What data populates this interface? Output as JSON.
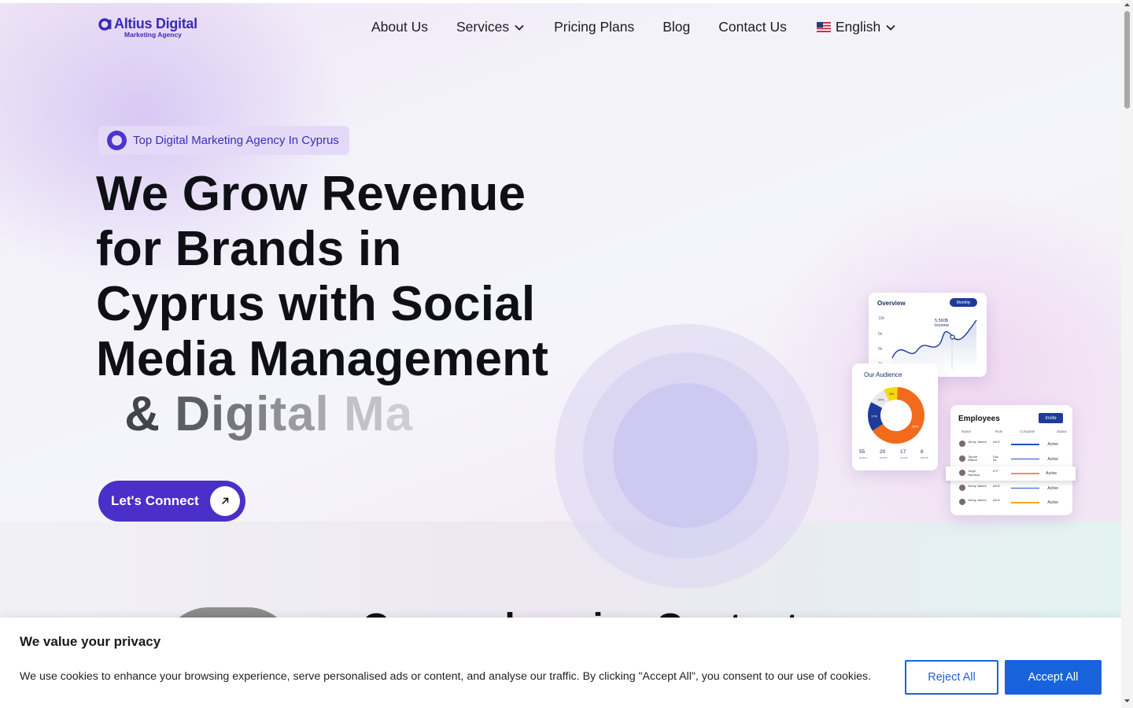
{
  "brand": {
    "name": "Altius Digital",
    "tagline": "Marketing Agency",
    "accent": "#4a2fc9"
  },
  "nav": {
    "items": [
      {
        "label": "About Us",
        "has_dropdown": false
      },
      {
        "label": "Services",
        "has_dropdown": true
      },
      {
        "label": "Pricing Plans",
        "has_dropdown": false
      },
      {
        "label": "Blog",
        "has_dropdown": false
      },
      {
        "label": "Contact Us",
        "has_dropdown": false
      }
    ],
    "language": {
      "label": "English",
      "icon": "us-flag-icon"
    }
  },
  "hero": {
    "badge": "Top Digital Marketing Agency In Cyprus",
    "title_lines": [
      "We Grow Revenue",
      "for Brands in",
      "Cyprus with Social",
      "Media Management"
    ],
    "typed_text": " & Digital Ma",
    "cta_label": "Let's Connect",
    "cta_icon": "arrow-up-right-icon"
  },
  "dashboard": {
    "overview": {
      "title": "Overview",
      "period": "Monthly",
      "y_ticks": [
        "10k",
        "5k",
        "5k",
        "1k"
      ],
      "value": "5,560$",
      "value_label": "Income"
    },
    "audience": {
      "title": "Our Audience",
      "slices": [
        {
          "label": "65%",
          "value": 65,
          "color": "#f26a1b"
        },
        {
          "label": "17%",
          "value": 17,
          "color": "#1e3a9a"
        },
        {
          "label": "20%",
          "value": 10,
          "color": "#e8e8ee"
        },
        {
          "label": "8%",
          "value": 8,
          "color": "#f5d90a"
        }
      ],
      "stats": [
        {
          "value": "55",
          "label": "years"
        },
        {
          "value": "20",
          "label": "years"
        },
        {
          "value": "17",
          "label": "years"
        },
        {
          "value": "8",
          "label": "years"
        }
      ]
    },
    "employees": {
      "title": "Employees",
      "invite_label": "Invite",
      "columns": [
        "Name",
        "Role",
        "Complete",
        "Status"
      ],
      "rows": [
        {
          "name": "Jenny James",
          "role": "Ad D",
          "status": "Active",
          "color": "#1e4fd0"
        },
        {
          "name": "Tyrone Wilson",
          "role": "Doc tor",
          "status": "Active",
          "color": "#1e4fd0"
        },
        {
          "name": "Jorge Harrison",
          "role": "D P",
          "status": "Active",
          "color": "#f08a6a"
        },
        {
          "name": "Jenny James",
          "role": "Ad D",
          "status": "Active",
          "color": "#1e4fd0"
        },
        {
          "name": "Jenny James",
          "role": "Ad D",
          "status": "Active",
          "color": "#f5a623"
        }
      ]
    }
  },
  "next_section": {
    "heading_peek": "Comprehensive Content"
  },
  "cookie": {
    "title": "We value your privacy",
    "text": "We use cookies to enhance your browsing experience, serve personalised ads or content, and analyse our traffic. By clicking \"Accept All\", you consent to our use of cookies.",
    "reject_label": "Reject All",
    "accept_label": "Accept All",
    "accent": "#1863dc"
  }
}
